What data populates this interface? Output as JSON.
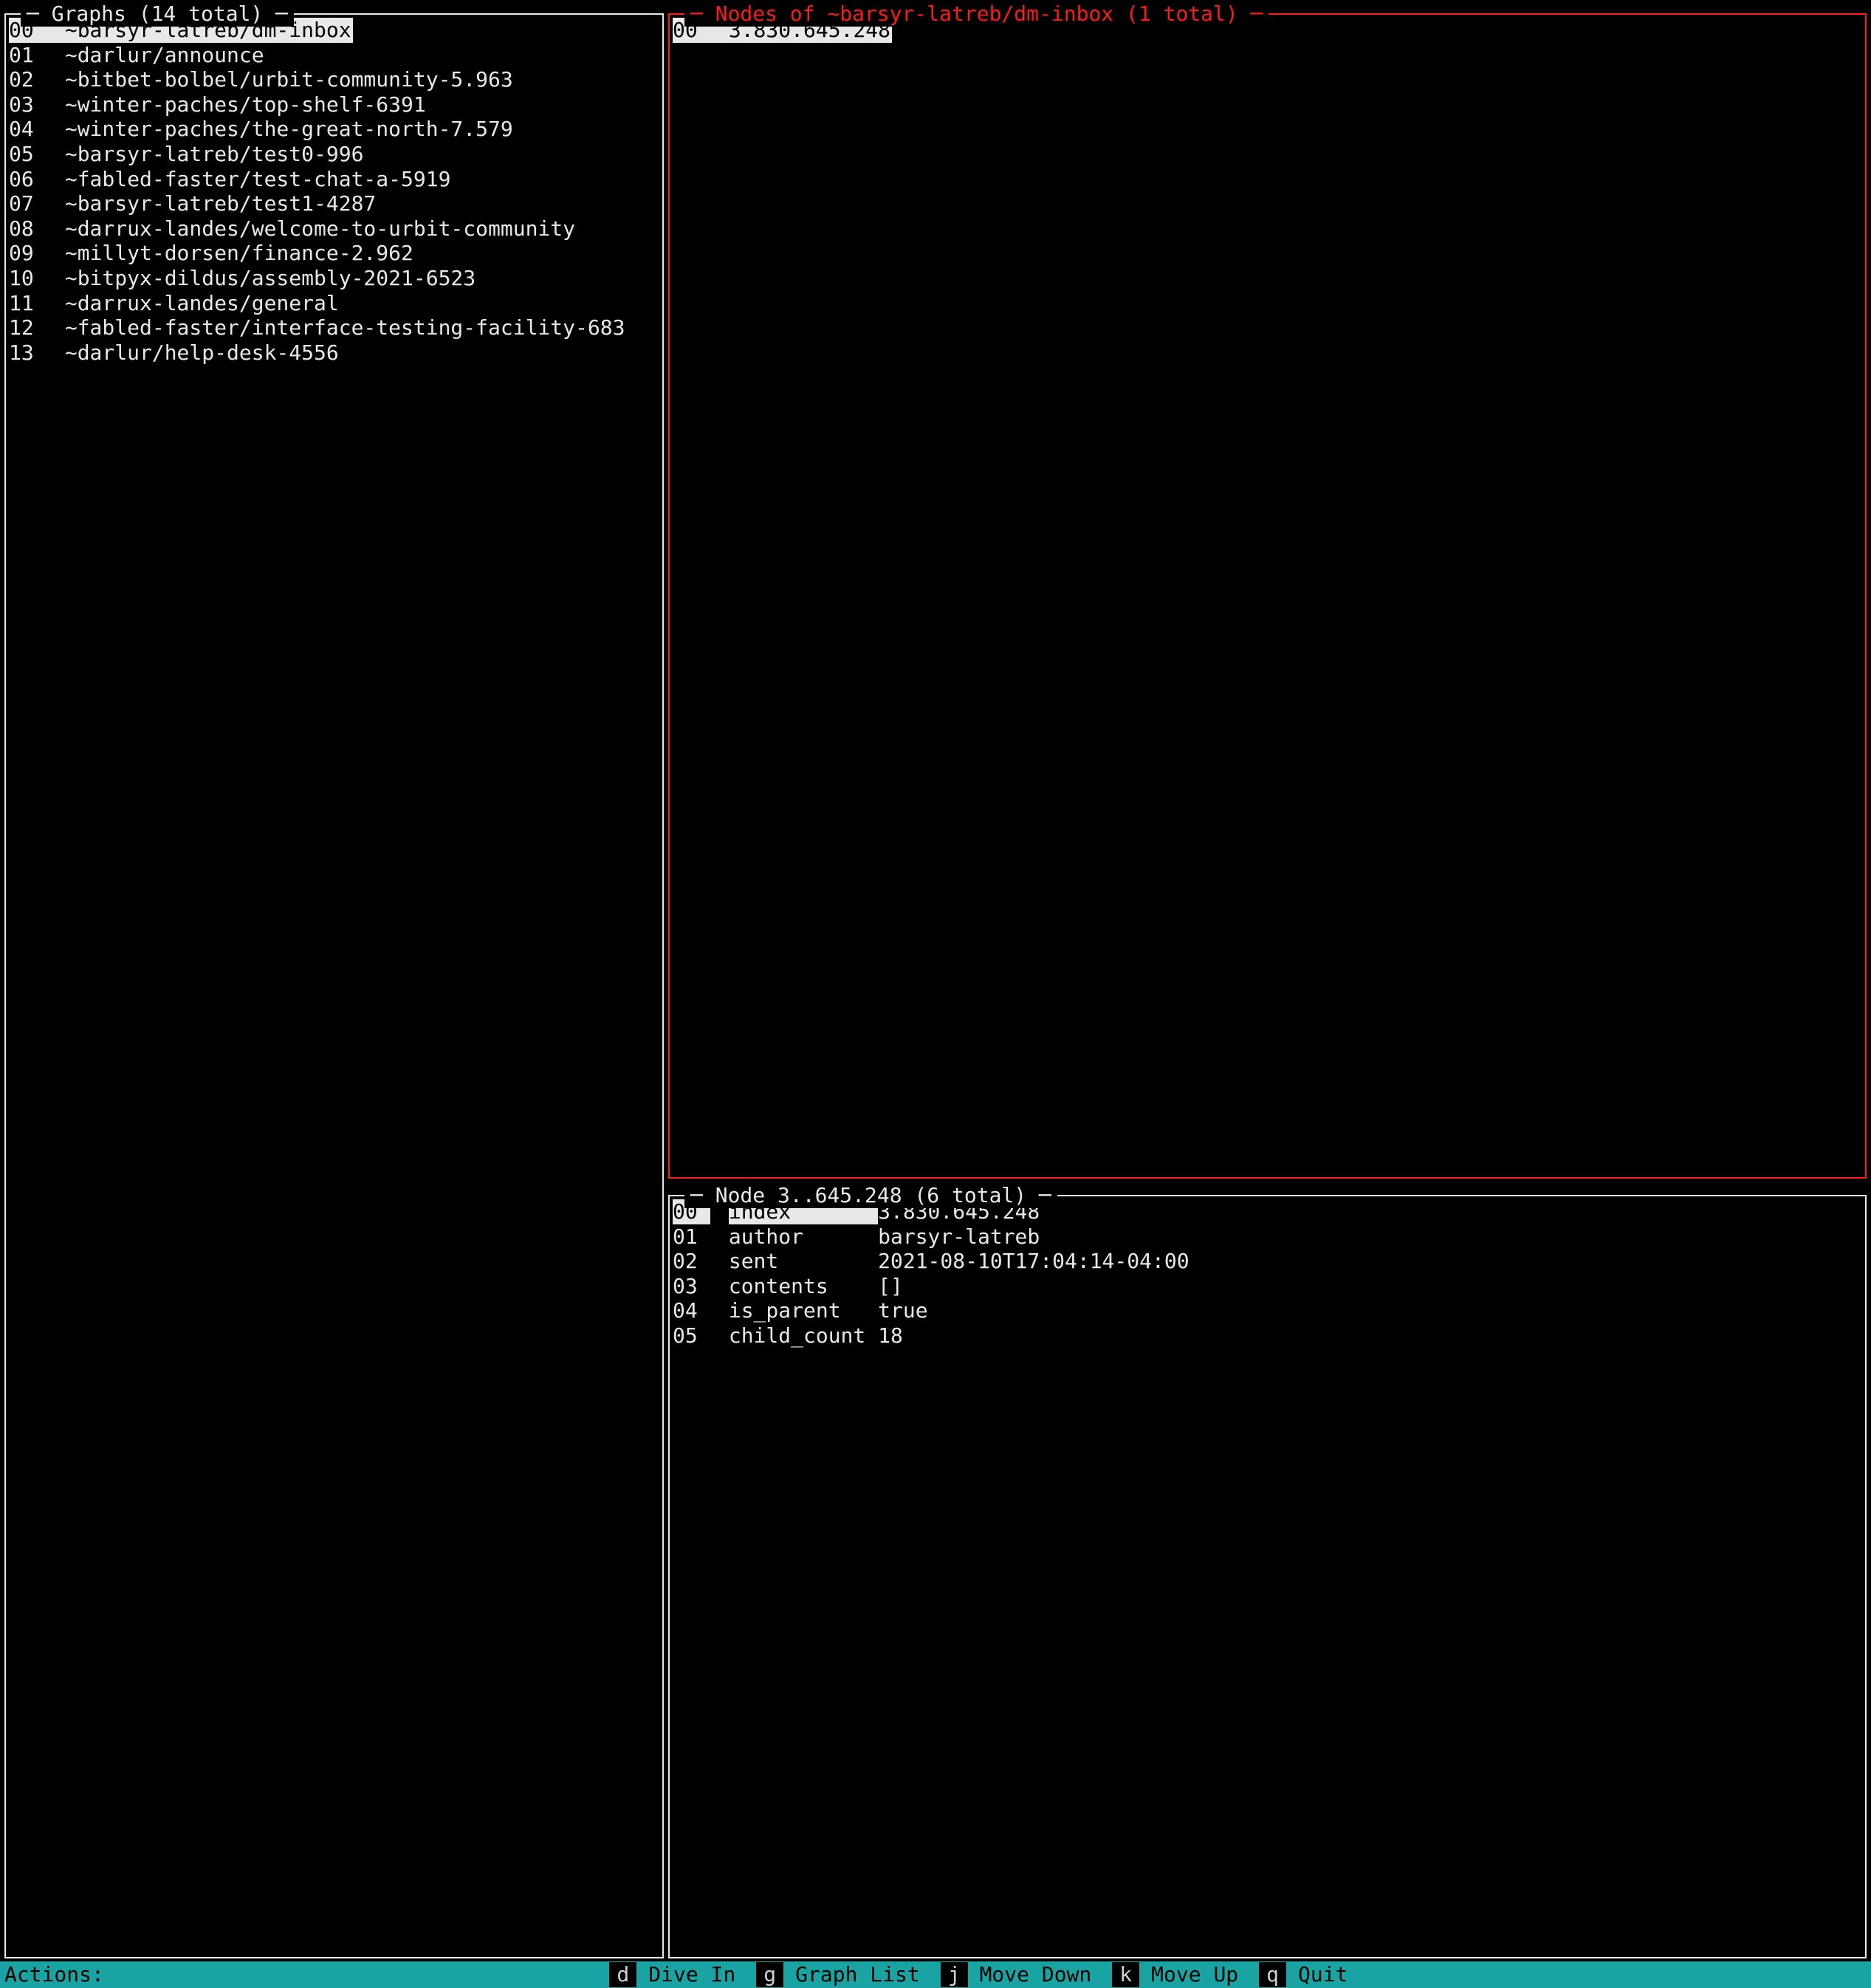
{
  "graphs": {
    "title": "─ Graphs (14 total) ─",
    "selected_index": 0,
    "items": [
      {
        "idx": "00",
        "label": "~barsyr-latreb/dm-inbox"
      },
      {
        "idx": "01",
        "label": "~darlur/announce"
      },
      {
        "idx": "02",
        "label": "~bitbet-bolbel/urbit-community-5.963"
      },
      {
        "idx": "03",
        "label": "~winter-paches/top-shelf-6391"
      },
      {
        "idx": "04",
        "label": "~winter-paches/the-great-north-7.579"
      },
      {
        "idx": "05",
        "label": "~barsyr-latreb/test0-996"
      },
      {
        "idx": "06",
        "label": "~fabled-faster/test-chat-a-5919"
      },
      {
        "idx": "07",
        "label": "~barsyr-latreb/test1-4287"
      },
      {
        "idx": "08",
        "label": "~darrux-landes/welcome-to-urbit-community"
      },
      {
        "idx": "09",
        "label": "~millyt-dorsen/finance-2.962"
      },
      {
        "idx": "10",
        "label": "~bitpyx-dildus/assembly-2021-6523"
      },
      {
        "idx": "11",
        "label": "~darrux-landes/general"
      },
      {
        "idx": "12",
        "label": "~fabled-faster/interface-testing-facility-683"
      },
      {
        "idx": "13",
        "label": "~darlur/help-desk-4556"
      }
    ]
  },
  "nodes": {
    "title": "─ Nodes of ~barsyr-latreb/dm-inbox (1 total) ─",
    "focused": true,
    "selected_index": 0,
    "items": [
      {
        "idx": "00",
        "label": "3.830.645.248"
      }
    ]
  },
  "node_detail": {
    "title": "─ Node 3..645.248 (6 total) ─",
    "selected_index": 0,
    "rows": [
      {
        "idx": "00",
        "key": "index",
        "value": "3.830.645.248"
      },
      {
        "idx": "01",
        "key": "author",
        "value": "barsyr-latreb"
      },
      {
        "idx": "02",
        "key": "sent",
        "value": "2021-08-10T17:04:14-04:00"
      },
      {
        "idx": "03",
        "key": "contents",
        "value": "[]"
      },
      {
        "idx": "04",
        "key": "is_parent",
        "value": "true"
      },
      {
        "idx": "05",
        "key": "child_count",
        "value": "18"
      }
    ]
  },
  "statusbar": {
    "label": "Actions:",
    "actions": [
      {
        "key": "d",
        "name": "Dive In"
      },
      {
        "key": "g",
        "name": "Graph List"
      },
      {
        "key": "j",
        "name": "Move Down"
      },
      {
        "key": "k",
        "name": "Move Up"
      },
      {
        "key": "q",
        "name": "Quit"
      }
    ]
  }
}
